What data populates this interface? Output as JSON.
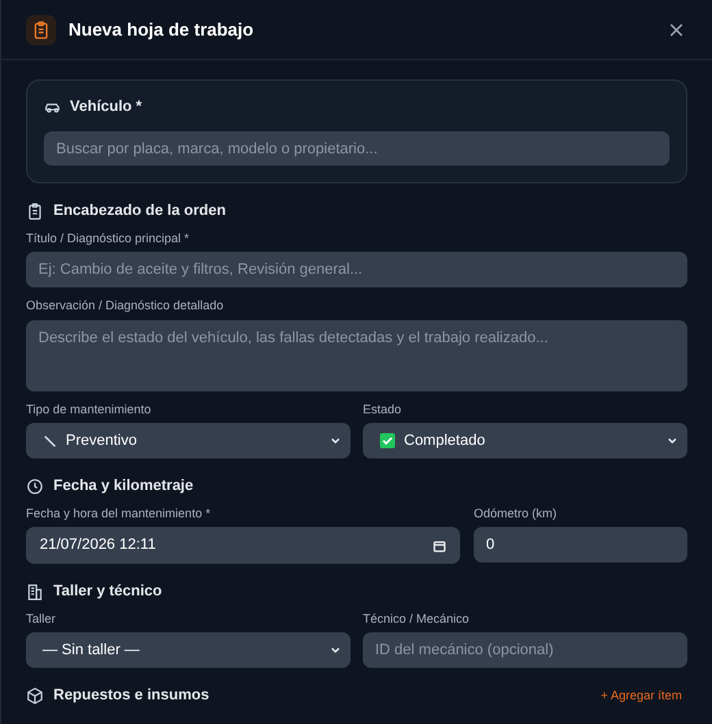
{
  "dialog": {
    "title": "Nueva hoja de trabajo"
  },
  "vehicle": {
    "label": "Vehículo *",
    "search": {
      "placeholder": "Buscar por placa, marca, modelo o propietario..."
    }
  },
  "sections": [
    {
      "kind": "header",
      "title": "Encabezado de la orden",
      "fields": [
        {
          "kind": "text",
          "label": "Título / Diagnóstico principal *",
          "placeholder": "Ej: Cambio de aceite y filtros, Revisión general..."
        },
        {
          "kind": "textarea",
          "label": "Observación / Diagnóstico detallado",
          "placeholder": "Describe el estado del vehículo, las fallas detectadas y el trabajo realizado..."
        },
        {
          "kind": "pair",
          "items": [
            {
              "kind": "select",
              "label": "Tipo de mantenimiento",
              "value": "Preventivo"
            },
            {
              "kind": "select",
              "label": "Estado",
              "value": "Completado"
            }
          ]
        }
      ]
    },
    {
      "kind": "clock",
      "title": "Fecha y kilometraje",
      "fields": [
        {
          "kind": "pair",
          "items": [
            {
              "kind": "date",
              "label": "Fecha y hora del mantenimiento *",
              "value": "21/07/2026 12:11"
            },
            {
              "kind": "text",
              "label": "Odómetro (km)",
              "value": "0"
            }
          ]
        }
      ]
    },
    {
      "kind": "building",
      "title": "Taller y técnico",
      "fields": [
        {
          "kind": "pair",
          "items": [
            {
              "kind": "select",
              "label": "Taller",
              "value": "— Sin taller —"
            },
            {
              "kind": "text",
              "label": "Técnico / Mecánico",
              "placeholder": "ID del mecánico (opcional)"
            }
          ]
        }
      ]
    },
    {
      "kind": "box",
      "title": "Repuestos e insumos",
      "action": "+ Agregar ítem"
    }
  ]
}
